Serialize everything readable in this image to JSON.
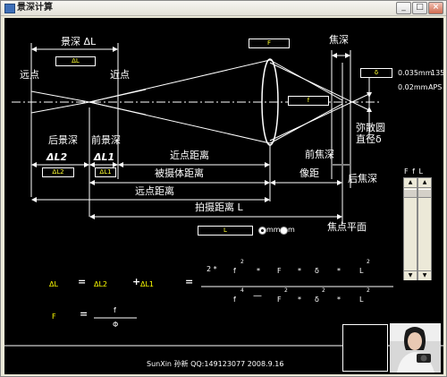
{
  "window": {
    "title": "景深计算",
    "min_btn": "_",
    "max_btn": "□",
    "close_btn": "×"
  },
  "diagram": {
    "far_point": "远点",
    "near_point": "近点",
    "depth_of_field": "景深 ΔL",
    "depth_of_focus": "焦深",
    "rear_dof": "后景深",
    "front_dof": "前景深",
    "dl2": "ΔL2",
    "dl1": "ΔL1",
    "near_distance": "近点距离",
    "subject_distance": "被摄体距离",
    "far_distance": "远点距离",
    "shooting_distance": "拍摄距离 L",
    "front_focus_depth": "前焦深",
    "image_distance": "像距",
    "rear_focus_depth": "后焦深",
    "coc": "弥散圆",
    "coc_diameter": "直径δ",
    "focal_plane": "焦点平面"
  },
  "fields": {
    "F": "F",
    "f": "f",
    "delta": "δ",
    "dL": "ΔL",
    "dL2": "ΔL2",
    "dL1": "ΔL1",
    "L": "L"
  },
  "presets": [
    {
      "value": "0.035mm",
      "label": "135"
    },
    {
      "value": "0.02mm",
      "label": "APS"
    }
  ],
  "units": {
    "mm": "mm",
    "m": "m",
    "selected": "mm"
  },
  "slider": {
    "label": "F  f  L"
  },
  "formula": {
    "dl": "ΔL",
    "eq1": "=",
    "dl2": "ΔL2",
    "plus": "+",
    "dl1": "ΔL1",
    "eq2": "=",
    "num_coef": "2 *",
    "num_f": "f",
    "num_exp2": "2",
    "num_dot1": "*",
    "num_F": "F",
    "num_dot2": "*",
    "num_delta": "δ",
    "num_dot3": "*",
    "num_L": "L",
    "num_exp2b": "2",
    "den_f": "f",
    "den_exp4": "4",
    "den_minus": "—",
    "den_F": "F",
    "den_exp2a": "2",
    "den_dot1": "*",
    "den_delta": "δ",
    "den_exp2b": "2",
    "den_dot2": "*",
    "den_L": "L",
    "den_exp2c": "2",
    "F_lbl": "F",
    "F_eq": "=",
    "F_num": "f",
    "F_den": "Φ"
  },
  "footer": {
    "credit": "SunXin  孙新  QQ:149123077  2008.9.16"
  }
}
